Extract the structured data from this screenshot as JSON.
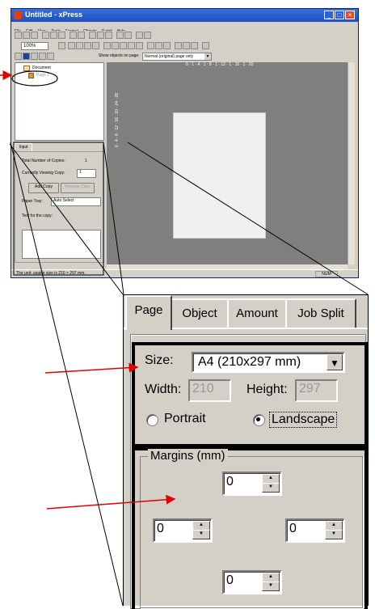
{
  "window": {
    "title": "Untitled - xPress",
    "controls": [
      "_",
      "□",
      "×"
    ]
  },
  "menu": [
    "File",
    "Edit",
    "View",
    "Tools",
    "Format",
    "Objects",
    "Script",
    "Help"
  ],
  "toolbar": {
    "zoom": "100%",
    "show_objects_label": "Show objects on page:",
    "show_objects_value": "Normal (original) page only"
  },
  "tree": {
    "document_label": "Document",
    "page_label": "Page 1"
  },
  "input_panel": {
    "tab_label": "Input",
    "total_copies_label": "Total Number of Copies:",
    "total_copies_value": "1",
    "viewing_copy_label": "Currently Viewing Copy:",
    "viewing_copy_value": "1",
    "add_copy": "Add Copy",
    "remove_copy": "Remove Copy",
    "paper_tray_label": "Paper Tray:",
    "paper_tray_value": "Auto Select",
    "text_for_copy_label": "Text for the copy:"
  },
  "canvas": {
    "ruler_h": "0 · 1 · 4 · 1 · 8 · 1 · 12 · 1 · 16 · 1 · 20",
    "ruler_v": "0 · 4 · 8 · 12 · 16 · 20 · 24 · 28"
  },
  "status": {
    "text": "The unit: usable size is 210 × 297 mm.",
    "right": "NUM"
  },
  "dialog": {
    "tabs": [
      "Page",
      "Object",
      "Amount",
      "Job Split"
    ],
    "size_label": "Size:",
    "size_value": "A4 (210x297 mm)",
    "width_label": "Width:",
    "width_value": "210",
    "height_label": "Height:",
    "height_value": "297",
    "portrait_label": "Portrait",
    "landscape_label": "Landscape",
    "orientation_selected": "Landscape",
    "margins_label": "Margins (mm)",
    "margin_top": "0",
    "margin_left": "0",
    "margin_right": "0",
    "margin_bottom": "0"
  },
  "annotation_color": "#e00000"
}
